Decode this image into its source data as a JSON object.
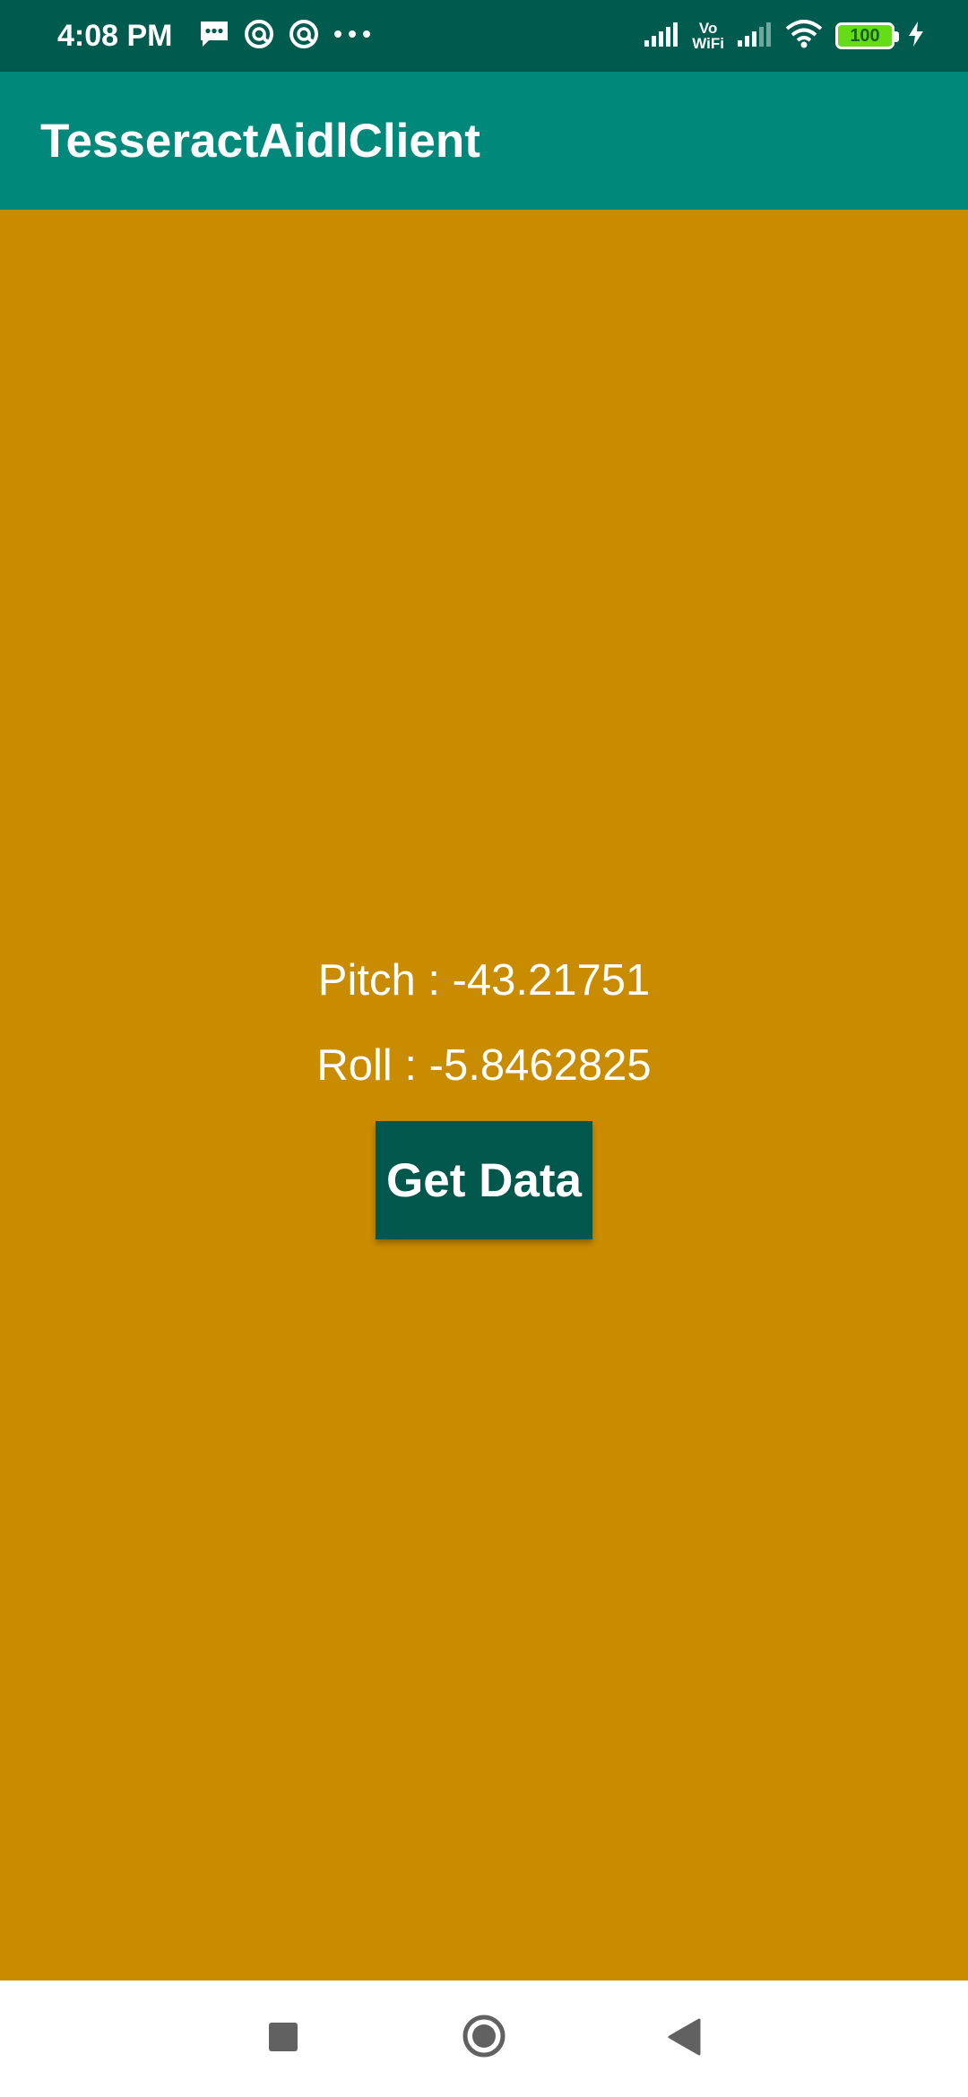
{
  "status_bar": {
    "time": "4:08 PM",
    "volte_top": "Vo",
    "volte_bottom": "WiFi",
    "battery": "100"
  },
  "app_bar": {
    "title": "TesseractAidlClient"
  },
  "main": {
    "pitch_text": "Pitch : -43.21751",
    "roll_text": "Roll : -5.8462825",
    "get_data_label": "Get Data"
  },
  "colors": {
    "status_bar": "#005b4f",
    "app_bar": "#00897b",
    "background": "#c98c00",
    "button": "#00574b"
  }
}
